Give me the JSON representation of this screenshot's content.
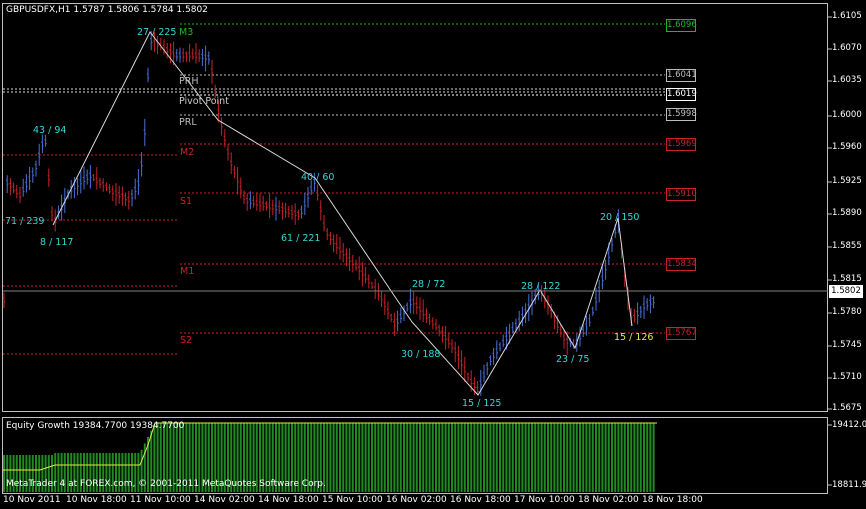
{
  "header": {
    "symbol_info": "GBPUSDFX,H1  1.5787 1.5806 1.5784 1.5802"
  },
  "levels": {
    "r3": "M3",
    "prh": "PRH",
    "pivot": "Pivot Point",
    "prl": "PRL",
    "m2": "M2",
    "s1": "S1",
    "m1": "M1",
    "s2": "S2"
  },
  "price_boxes": {
    "top": "1.6096",
    "b1": "1.6041",
    "b2": "1.6019",
    "b3": "1.5998",
    "b4": "1.5969",
    "b5": "1.5910",
    "b6": "1.5834",
    "b7": "1.5767",
    "current": "1.5802"
  },
  "zigzag_labels": {
    "z1": "27 / 225",
    "z2": "43 / 94",
    "z3": "71 / 239",
    "z4": "8 / 117",
    "z5": "40 / 60",
    "z6": "61 / 221",
    "z7": "28 / 72",
    "z8": "30 / 188",
    "z9": "15 / 125",
    "z10": "28 / 122",
    "z11": "23 / 75",
    "z12": "20 / 150",
    "z13": "15 / 126"
  },
  "y_axis": {
    "t1": "1.6105",
    "t2": "1.6070",
    "t3": "1.6035",
    "t4": "1.6000",
    "t5": "1.5960",
    "t6": "1.5925",
    "t7": "1.5890",
    "t8": "1.5855",
    "t9": "1.5815",
    "t10": "1.5780",
    "t11": "1.5745",
    "t12": "1.5710",
    "t13": "1.5675"
  },
  "x_axis": {
    "d1": "10 Nov 2011",
    "d2": "10 Nov 18:00",
    "d3": "11 Nov 10:00",
    "d4": "14 Nov 02:00",
    "d5": "14 Nov 18:00",
    "d6": "15 Nov 10:00",
    "d7": "16 Nov 02:00",
    "d8": "16 Nov 18:00",
    "d9": "17 Nov 10:00",
    "d10": "18 Nov 02:00",
    "d11": "18 Nov 18:00"
  },
  "equity": {
    "title": "Equity Growth 19384.7700 19384.7700",
    "y_top": "19412.0",
    "y_bottom": "18811.9",
    "footer": "MetaTrader 4 at FOREX.com, © 2001-2011 MetaQuotes Software Corp."
  },
  "colors": {
    "bull": "#4a6fd8",
    "bear": "#c8232a",
    "zigzag": "#d8d8d8",
    "equity_bar": "#1f8a1f",
    "equity_line": "#e8e84a",
    "resistance": "#c8232a",
    "support_green": "#22b622"
  }
}
